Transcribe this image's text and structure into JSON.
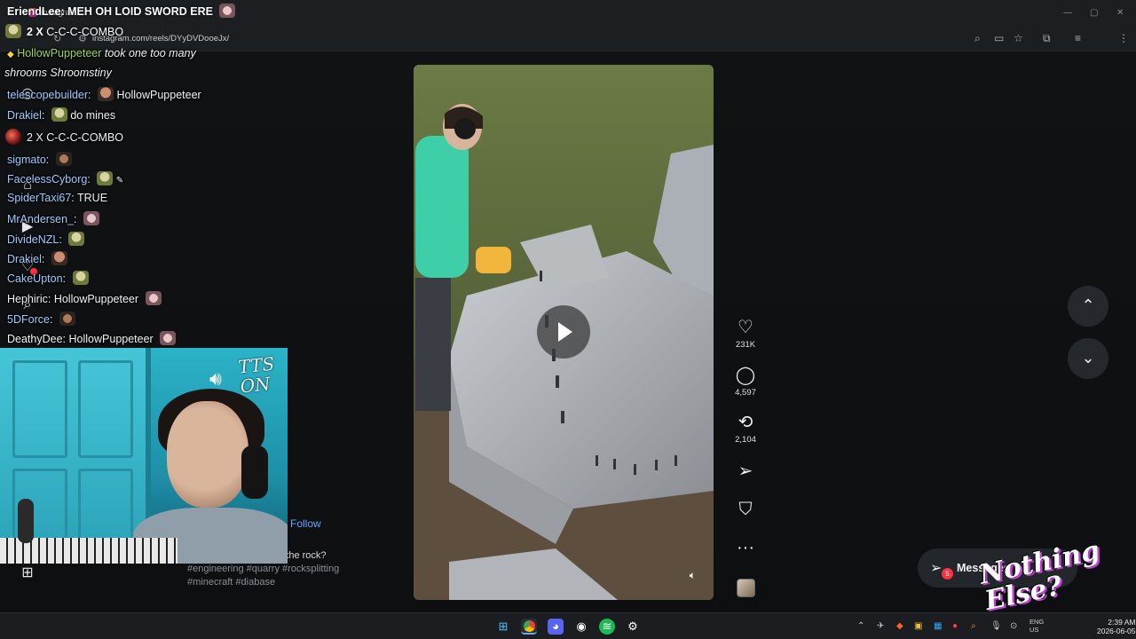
{
  "browser": {
    "tab_title": "Instagram",
    "url": "instagram.com/reels/DYyDVDooeJx/",
    "window_controls": {
      "minimize": "—",
      "maximize": "▢",
      "close": "✕"
    }
  },
  "stream_overlay": {
    "banner": {
      "user": "EriendLee",
      "message": "MEH OH LOID SWORD ERE"
    },
    "combo_top": {
      "count": "2 X",
      "label": "C-C-C-COMBO"
    },
    "chat": [
      {
        "user": "HollowPuppeteer",
        "message": "took one too many",
        "style": "green-italic"
      },
      {
        "user": "",
        "message": "shrooms Shroomstiny",
        "style": "italic"
      },
      {
        "user": "telescopebuilder",
        "message": "HollowPuppeteer"
      },
      {
        "user": "Drakiel",
        "message": "do mines"
      },
      {
        "user": "",
        "message": "2 X C-C-C-COMBO",
        "style": "combo"
      },
      {
        "user": "sigmato",
        "message": ""
      },
      {
        "user": "FacelessCyborg",
        "message": ""
      },
      {
        "user": "SpiderTaxi67",
        "message": "TRUE"
      },
      {
        "user": "MrAndersen_",
        "message": ""
      },
      {
        "user": "DivideNZL",
        "message": ""
      },
      {
        "user": "Drakiel",
        "message": ""
      },
      {
        "user": "CakeUpton",
        "message": ""
      },
      {
        "user": "Hephiric",
        "message": "HollowPuppeteer",
        "style": "plain-user"
      },
      {
        "user": "5DForce",
        "message": ""
      },
      {
        "user": "DeathyDee",
        "message": "HollowPuppeteer",
        "style": "plain-user"
      }
    ],
    "tts_label": "TTS ON",
    "logo_text": "Nothing Else?"
  },
  "reel": {
    "follow_label": "Follow",
    "caption": "ich wedge will fracture the rock?",
    "hashtags": "#engineering #quarry #rocksplitting #minecraft #diabase",
    "actions": [
      {
        "icon": "heart-icon",
        "glyph": "♡",
        "count": "231K"
      },
      {
        "icon": "comment-icon",
        "glyph": "◯",
        "count": "4,597"
      },
      {
        "icon": "repost-icon",
        "glyph": "⟲",
        "count": "2,104"
      },
      {
        "icon": "share-icon",
        "glyph": "➢",
        "count": ""
      },
      {
        "icon": "bookmark-icon",
        "glyph": "⛉",
        "count": ""
      },
      {
        "icon": "more-icon",
        "glyph": "···",
        "count": ""
      }
    ]
  },
  "messages": {
    "label": "Messages",
    "badge": "5"
  },
  "navigation": {
    "up": "⌃",
    "down": "⌄"
  },
  "taskbar": {
    "time": "2:39 AM",
    "date": "2026-06-05",
    "lang_top": "ENG",
    "lang_bottom": "US"
  },
  "colors": {
    "username": "#9ecbff",
    "username_highlight": "#9bd45a",
    "follow": "#6aa4ff",
    "badge": "#ff3040"
  }
}
